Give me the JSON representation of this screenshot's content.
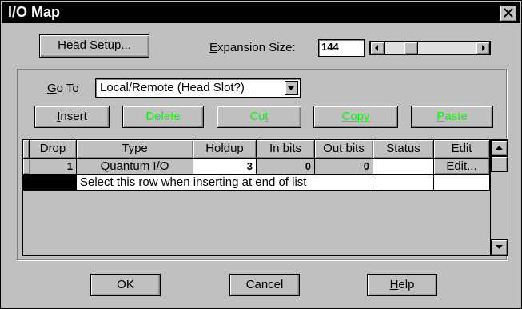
{
  "window": {
    "title": "I/O Map"
  },
  "top": {
    "head_setup_pre": "Head ",
    "head_setup_u": "S",
    "head_setup_post": "etup...",
    "expansion_u": "E",
    "expansion_label_post": "xpansion  Size:",
    "expansion_value": "144",
    "expansion_slider_position": 0.25
  },
  "goto": {
    "label_u": "G",
    "label_post": "o To",
    "selected": "Local/Remote (Head Slot?)"
  },
  "actions": {
    "insert_u": "I",
    "insert_post": "nsert",
    "delete_label": "Delete",
    "cut_pre": "Cu",
    "cut_u": "t",
    "copy_label": "Copy",
    "paste_u": "P",
    "paste_post": "aste"
  },
  "table": {
    "columns": [
      "Drop",
      "Type",
      "Holdup",
      "In bits",
      "Out bits",
      "Status",
      "Edit"
    ],
    "rows": [
      {
        "drop": "1",
        "type": "Quantum  I/O",
        "holdup": "3",
        "in_bits": "0",
        "out_bits": "0",
        "status": "",
        "edit": "Edit..."
      }
    ],
    "insert_row_label": "Select this row when inserting at end of list"
  },
  "footer": {
    "ok": "OK",
    "cancel": "Cancel",
    "help_u": "H",
    "help_post": "elp"
  },
  "colors": {
    "green_button_text": "#00ff00",
    "title_bar": "#000000",
    "face": "#c0c0c0"
  }
}
